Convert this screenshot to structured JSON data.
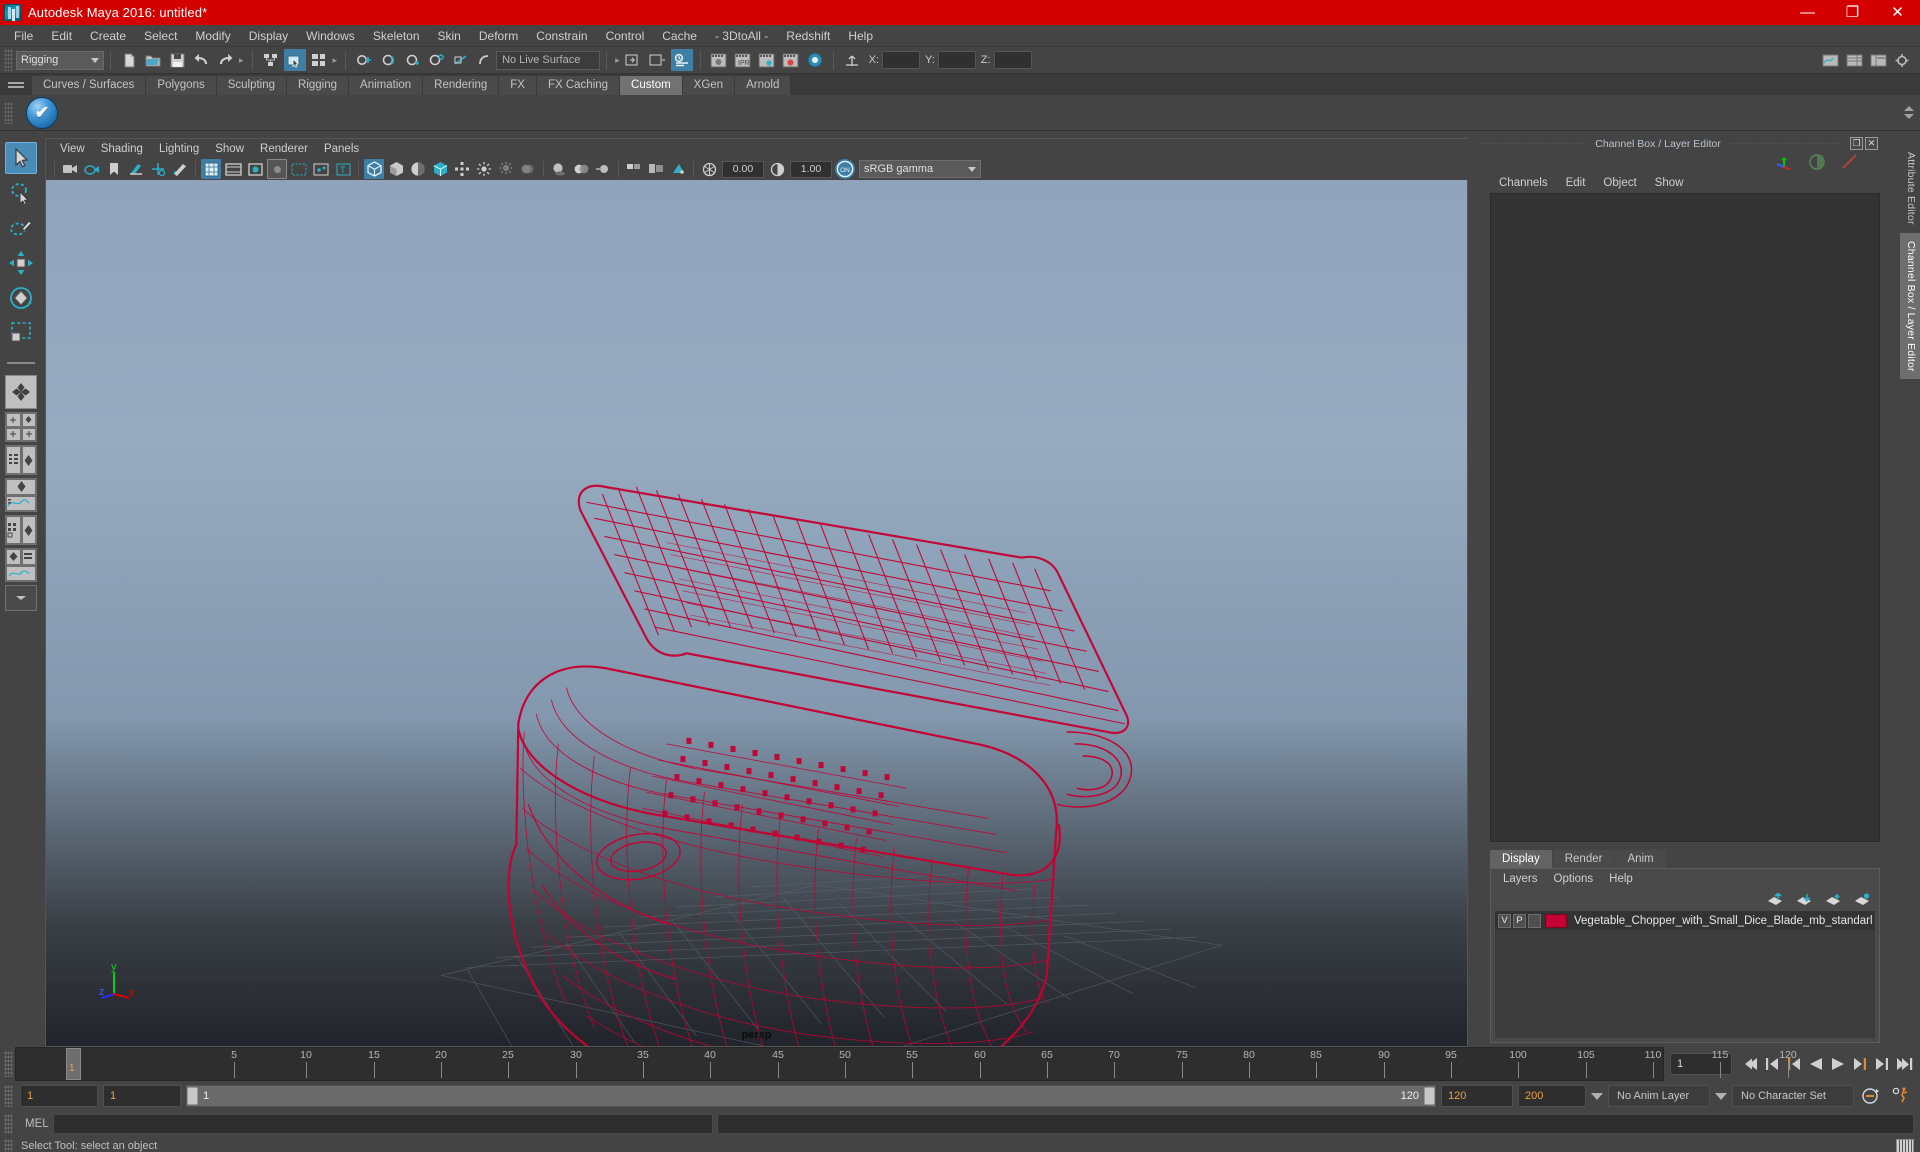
{
  "window": {
    "title": "Autodesk Maya 2016: untitled*",
    "logo_icon": "maya-logo-icon",
    "buttons": [
      {
        "name": "minimize-button",
        "glyph": "—"
      },
      {
        "name": "maximize-button",
        "glyph": "❐"
      },
      {
        "name": "close-button",
        "glyph": "✕"
      }
    ],
    "titlebar_color": "#d40000"
  },
  "menubar": {
    "items": [
      "File",
      "Edit",
      "Create",
      "Select",
      "Modify",
      "Display",
      "Windows",
      "Skeleton",
      "Skin",
      "Deform",
      "Constrain",
      "Control",
      "Cache",
      "- 3DtoAll -",
      "Redshift",
      "Help"
    ]
  },
  "statusline": {
    "mode": "Rigging",
    "live_surface": "No Live Surface",
    "coords": {
      "x_label": "X:",
      "y_label": "Y:",
      "z_label": "Z:",
      "x_value": "",
      "y_value": "",
      "z_value": ""
    },
    "icons": [
      "new-scene-icon",
      "open-scene-icon",
      "save-scene-icon",
      "undo-icon",
      "redo-icon",
      "select-by-hierarchy-icon",
      "select-by-object-icon",
      "select-by-component-icon",
      "snap-to-grid-icon",
      "snap-to-curve-icon",
      "snap-to-point-icon",
      "snap-to-projected-center-icon",
      "snap-to-view-plane-icon",
      "make-live-icon",
      "open-sidebar-left-icon",
      "open-sidebar-right-icon",
      "attribute-editor-icon",
      "render-current-frame-icon",
      "ipr-render-icon",
      "render-settings-icon",
      "hypershade-icon",
      "render-view-icon"
    ],
    "right_icons": [
      "show-hide-anim-editors-icon",
      "show-hide-channel-box-icon",
      "show-hide-attribute-editor-icon",
      "show-hide-tool-settings-icon"
    ]
  },
  "shelf": {
    "tabs": [
      {
        "label": "Curves / Surfaces",
        "active": false
      },
      {
        "label": "Polygons",
        "active": false
      },
      {
        "label": "Sculpting",
        "active": false
      },
      {
        "label": "Rigging",
        "active": false
      },
      {
        "label": "Animation",
        "active": false
      },
      {
        "label": "Rendering",
        "active": false
      },
      {
        "label": "FX",
        "active": false
      },
      {
        "label": "FX Caching",
        "active": false
      },
      {
        "label": "Custom",
        "active": true
      },
      {
        "label": "XGen",
        "active": false
      },
      {
        "label": "Arnold",
        "active": false
      }
    ],
    "menu_icon": "shelf-menu-icon",
    "items": [
      {
        "name": "blue-checkmark-shelf-icon"
      }
    ]
  },
  "toolbox": {
    "tools": [
      {
        "name": "select-tool",
        "icon": "arrow-cursor-icon",
        "selected": true
      },
      {
        "name": "lasso-select-tool",
        "icon": "lasso-icon",
        "selected": false
      },
      {
        "name": "paint-select-tool",
        "icon": "paint-brush-icon",
        "selected": false
      },
      {
        "name": "move-tool",
        "icon": "move-arrows-icon",
        "selected": false
      },
      {
        "name": "rotate-tool",
        "icon": "rotate-circle-icon",
        "selected": false
      },
      {
        "name": "scale-tool",
        "icon": "scale-box-icon",
        "selected": false
      }
    ],
    "layouts": [
      {
        "name": "single-perspective-layout",
        "icon": "four-diamond-icon"
      },
      {
        "name": "four-view-layout",
        "icon": "quad-view-icon"
      },
      {
        "name": "outliner-persp-layout",
        "icon": "outliner-persp-icon"
      },
      {
        "name": "persp-graph-layout",
        "icon": "persp-graph-icon"
      },
      {
        "name": "hypershade-persp-layout",
        "icon": "hypershade-persp-icon"
      },
      {
        "name": "persp-graph-outliner-layout",
        "icon": "persp-graph-outliner-icon"
      },
      {
        "name": "more-layouts-button",
        "icon": "chevron-down-icon"
      }
    ]
  },
  "viewport": {
    "panel_menus": [
      "View",
      "Shading",
      "Lighting",
      "Show",
      "Renderer",
      "Panels"
    ],
    "camera_label": "persp",
    "exposure_value": "0.00",
    "gamma_value": "1.00",
    "color_management": "sRGB gamma",
    "color_management_toggle": "ON",
    "axis_gizmo": {
      "x": "x",
      "y": "y",
      "z": "z"
    },
    "model_color": "#c40233",
    "toolbar_icons": [
      "select-camera-icon",
      "camera-attributes-icon",
      "bookmark-icon",
      "image-plane-icon",
      "two-d-pan-zoom-icon",
      "grease-pencil-icon",
      "grid-toggle-icon",
      "film-gate-icon",
      "resolution-gate-icon",
      "gate-mask-icon",
      "field-chart-icon",
      "safe-action-icon",
      "safe-title-icon",
      "wireframe-shading-icon",
      "smooth-shade-all-icon",
      "shade-selected-items-icon",
      "wireframe-on-shaded-icon",
      "xray-icon",
      "xray-joints-icon",
      "use-default-light-icon",
      "use-all-lights-icon",
      "shadows-icon",
      "screen-space-ao-icon",
      "motion-blur-icon",
      "multisample-aa-icon",
      "depth-of-field-icon",
      "isolate-select-icon"
    ]
  },
  "channel_box": {
    "panel_title": "Channel Box / Layer Editor",
    "window_buttons": [
      "undock-icon",
      "close-icon"
    ],
    "header_icons": [
      "axis-manipulator-icon",
      "channel-display-icon",
      "pencil-icon"
    ],
    "menus": [
      "Channels",
      "Edit",
      "Object",
      "Show"
    ]
  },
  "layer_editor": {
    "tabs": [
      {
        "label": "Display",
        "active": true
      },
      {
        "label": "Render",
        "active": false
      },
      {
        "label": "Anim",
        "active": false
      }
    ],
    "menus": [
      "Layers",
      "Options",
      "Help"
    ],
    "tool_icons": [
      "move-layer-up-icon",
      "move-layer-down-icon",
      "new-layer-icon",
      "new-layer-from-selected-icon"
    ],
    "layers": [
      {
        "visibility": "V",
        "playback": "P",
        "type": "",
        "color": "#c40233",
        "name": "Vegetable_Chopper_with_Small_Dice_Blade_mb_standarl"
      }
    ]
  },
  "side_tabs": [
    {
      "label": "Attribute Editor",
      "active": false
    },
    {
      "label": "Channel Box / Layer Editor",
      "active": true
    }
  ],
  "timeline": {
    "start": 1,
    "end": 120,
    "current_frame": "1",
    "ticks": [
      5,
      10,
      15,
      20,
      25,
      30,
      35,
      40,
      45,
      50,
      55,
      60,
      65,
      70,
      75,
      80,
      85,
      90,
      95,
      100,
      105,
      110,
      115,
      120
    ],
    "playback_buttons": [
      "go-to-start-icon",
      "step-back-keyframe-icon",
      "step-back-frame-icon",
      "play-backwards-icon",
      "play-forwards-icon",
      "step-forward-frame-icon",
      "step-forward-keyframe-icon",
      "go-to-end-icon"
    ]
  },
  "range_slider": {
    "anim_start": "1",
    "range_start": "1",
    "bar_start": "1",
    "bar_end": "120",
    "range_end": "120",
    "anim_end": "200",
    "anim_layer": "No Anim Layer",
    "character_set": "No Character Set",
    "right_icons": [
      "auto-key-icon",
      "animation-preferences-icon"
    ]
  },
  "command_line": {
    "language_label": "MEL",
    "input_value": "",
    "input_placeholder": ""
  },
  "status_bar": {
    "message": "Select Tool: select an object",
    "help_icon": "help-line-icon"
  }
}
